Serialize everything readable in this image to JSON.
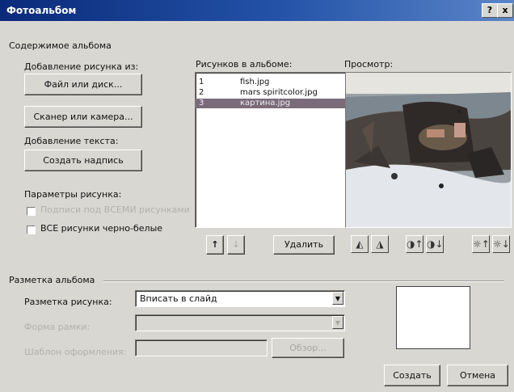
{
  "window": {
    "title": "Фотоальбом",
    "help_button": "?",
    "close_button": "x"
  },
  "album_contents": {
    "section_label": "Содержимое альбома",
    "add_picture_from": "Добавление рисунка из:",
    "file_or_disk_button": "Файл или диск...",
    "scanner_or_camera_button": "Сканер или камера...",
    "add_text": "Добавление текста:",
    "create_caption_button": "Создать надпись",
    "picture_options": "Параметры рисунка:",
    "caption_below_all_option": "Подписи под ВСЕМИ рисунками",
    "all_black_white_option": "ВСЕ рисунки черно-белые"
  },
  "pictures_list": {
    "label": "Рисунков в альбоме:",
    "items": [
      {
        "num": "1",
        "name": "fish.jpg",
        "selected": false
      },
      {
        "num": "2",
        "name": "mars spiritcolor.jpg",
        "selected": false
      },
      {
        "num": "3",
        "name": "картина.jpg",
        "selected": true
      }
    ],
    "move_up_icon": "up-arrow",
    "move_down_icon": "down-arrow",
    "delete_button": "Удалить"
  },
  "preview": {
    "label": "Просмотр:",
    "tools": [
      "rotate-left-icon",
      "rotate-right-icon",
      "contrast-up-icon",
      "contrast-down-icon",
      "brightness-up-icon",
      "brightness-down-icon"
    ]
  },
  "layout": {
    "section_label": "Разметка альбома",
    "picture_layout_label": "Разметка рисунка:",
    "picture_layout_value": "Вписать в слайд",
    "frame_shape_label": "Форма рамки:",
    "design_template_label": "Шаблон оформления:",
    "browse_button": "Обзор..."
  },
  "footer": {
    "create_button": "Создать",
    "cancel_button": "Отмена"
  },
  "colors": {
    "title_gradient_start": "#0a2a7a",
    "title_gradient_end": "#5b85c8",
    "selection": "#7b6b7a",
    "dialog_bg": "#d9d7d2"
  }
}
